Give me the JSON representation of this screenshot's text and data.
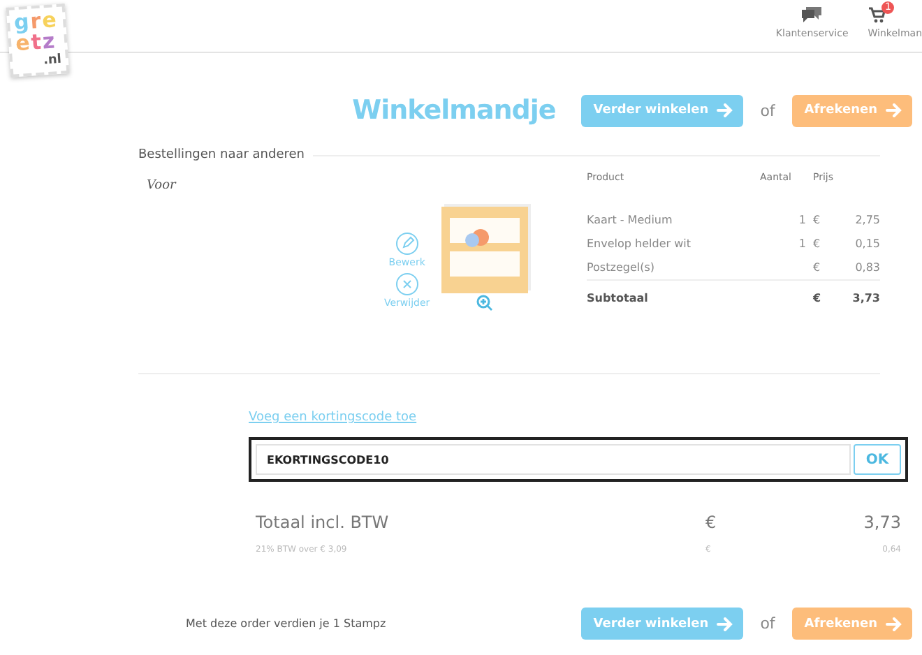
{
  "header": {
    "logo": {
      "lines": [
        "gre",
        "etz"
      ],
      "suffix": ".nl"
    },
    "nav": [
      {
        "kind": "service",
        "label": "Klantenservice"
      },
      {
        "kind": "cart",
        "label": "Winkelman",
        "badge": "1"
      }
    ]
  },
  "title": "Winkelmandje",
  "top_actions": {
    "continue": "Verder winkelen",
    "separator": "of",
    "checkout": "Afrekenen"
  },
  "orders": {
    "heading": "Bestellingen naar anderen",
    "recipient_label": "Voor",
    "card_actions": [
      {
        "kind": "edit",
        "label": "Bewerk"
      },
      {
        "kind": "remove",
        "label": "Verwijder"
      }
    ],
    "table": {
      "columns": [
        "Product",
        "Aantal",
        "Prijs"
      ],
      "rows": [
        {
          "product": "Kaart - Medium",
          "quantity": "1",
          "currency": "€",
          "price": "2,75"
        },
        {
          "product": "Envelop helder wit",
          "quantity": "1",
          "currency": "€",
          "price": "0,15"
        },
        {
          "product": "Postzegel(s)",
          "currency": "€",
          "price": "0,83"
        }
      ],
      "subtotal": {
        "label": "Subtotaal",
        "currency": "€",
        "price": "3,73"
      }
    }
  },
  "discount": {
    "link": "Voeg een kortingscode toe",
    "value": "EKORTINGSCODE10",
    "button": "OK"
  },
  "total": {
    "label": "Totaal incl. BTW",
    "currency": "€",
    "amount": "3,73"
  },
  "vat": {
    "label": "21% BTW over € 3,09",
    "currency": "€",
    "amount": "0,64"
  },
  "footer": {
    "note": "Met deze order verdien je 1 Stampz",
    "continue": "Verder winkelen",
    "separator": "of",
    "checkout": "Afrekenen"
  }
}
